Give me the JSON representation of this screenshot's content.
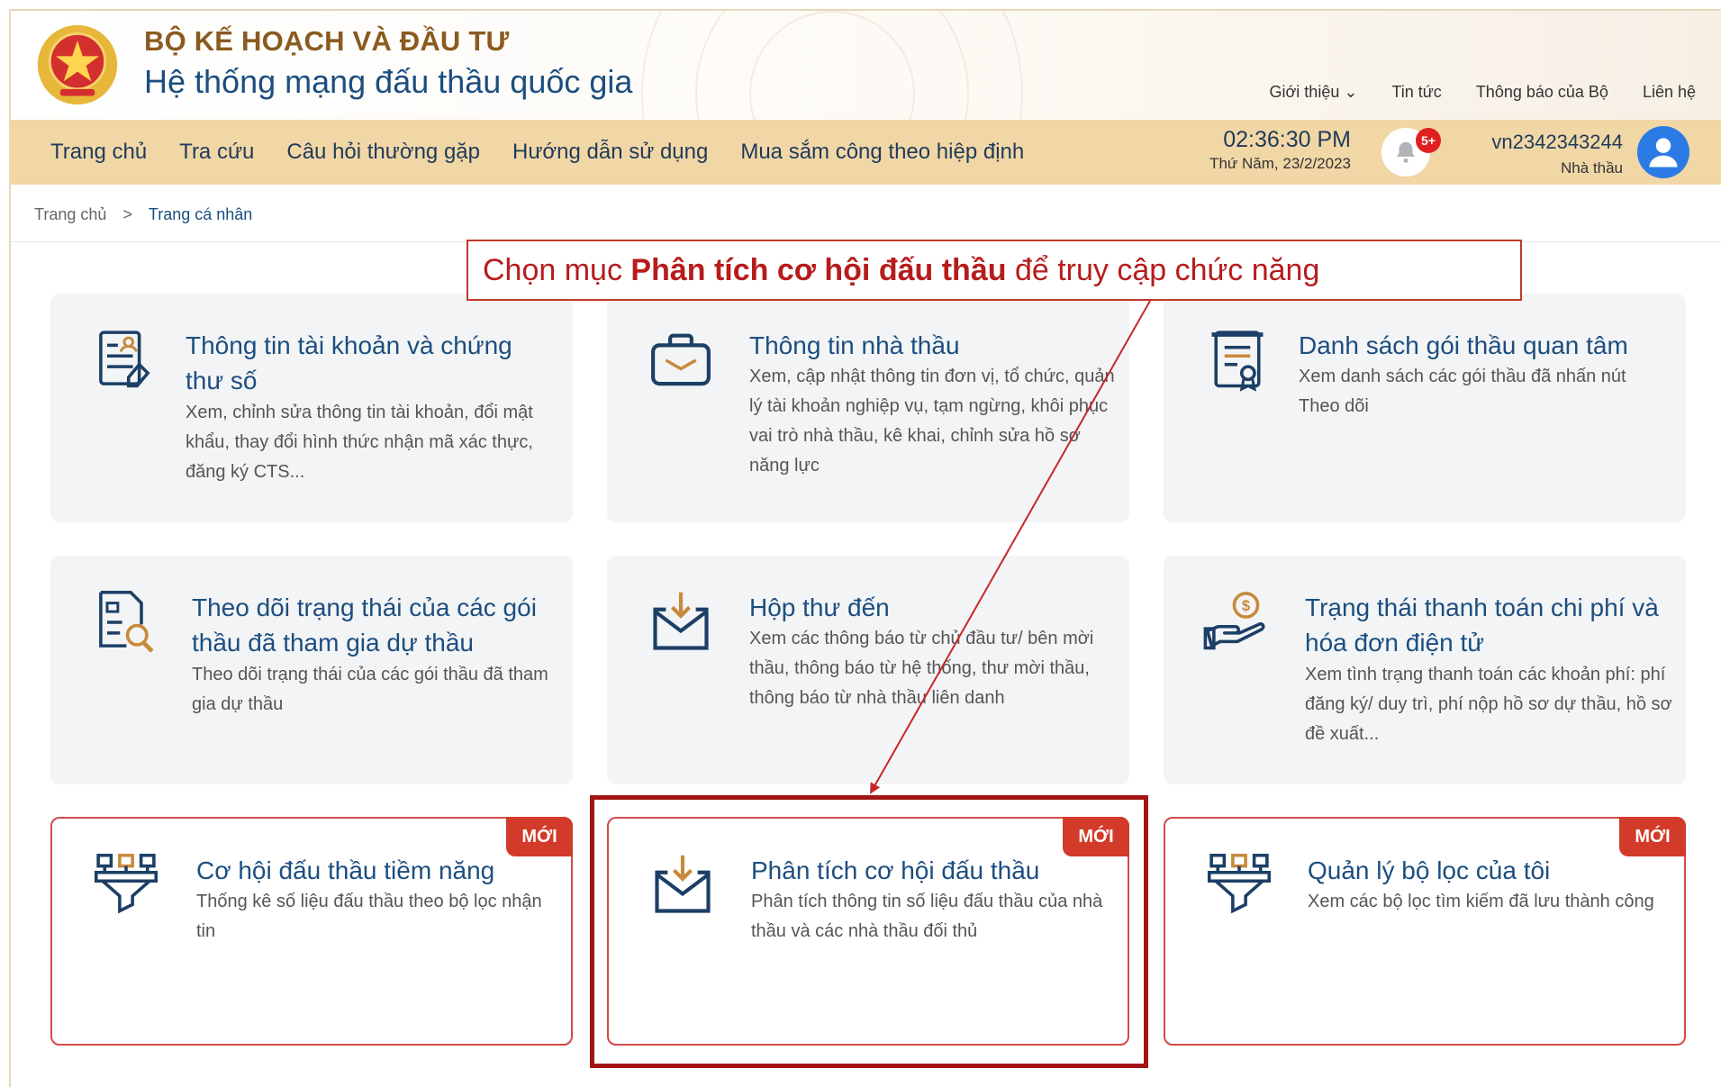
{
  "header": {
    "ministry": "BỘ KẾ HOẠCH VÀ ĐẦU TƯ",
    "system_name": "Hệ thống mạng đấu thầu quốc gia",
    "top_links": [
      "Giới thiệu ⌄",
      "Tin tức",
      "Thông báo của Bộ",
      "Liên hệ"
    ]
  },
  "nav": {
    "items": [
      "Trang chủ",
      "Tra cứu",
      "Câu hỏi thường gặp",
      "Hướng dẫn sử dụng",
      "Mua sắm công theo hiệp định"
    ],
    "time": "02:36:30 PM",
    "date": "Thứ Năm, 23/2/2023",
    "notification_badge": "5+",
    "username": "vn2342343244",
    "role": "Nhà thầu"
  },
  "breadcrumb": [
    "Trang chủ",
    ">",
    "Trang cá nhân"
  ],
  "callout": {
    "prefix": "Chọn mục ",
    "bold": "Phân tích cơ hội đấu thầu",
    "suffix": " để truy cập chức năng"
  },
  "new_label": "MỚI",
  "cards": [
    {
      "title": "Thông tin tài khoản và chứng thư số",
      "desc": "Xem, chỉnh sửa thông tin tài khoản, đổi mật khẩu, thay đổi hình thức nhận mã xác thực, đăng ký CTS...",
      "icon": "account-doc-icon"
    },
    {
      "title": "Thông tin nhà thầu",
      "desc": "Xem, cập nhật thông tin đơn vị, tổ chức, quản lý tài khoản nghiệp vụ, tạm ngừng, khôi phục vai trò nhà thầu, kê khai, chỉnh sửa hồ sơ năng lực",
      "icon": "briefcase-icon"
    },
    {
      "title": "Danh sách gói thầu quan tâm",
      "desc": "Xem danh sách các gói thầu đã nhấn nút Theo dõi",
      "icon": "certificate-icon"
    },
    {
      "title": "Theo dõi trạng thái của các gói thầu đã tham gia dự thầu",
      "desc": "Theo dõi trạng thái của các gói thầu đã tham gia dự thầu",
      "icon": "doc-search-icon"
    },
    {
      "title": "Hộp thư đến",
      "desc": "Xem các thông báo từ chủ đầu tư/ bên mời thầu, thông báo từ hệ thống, thư mời thầu, thông báo từ nhà thầu liên danh",
      "icon": "inbox-icon"
    },
    {
      "title": "Trạng thái thanh toán chi phí và hóa đơn điện tử",
      "desc": "Xem tình trạng thanh toán các khoản phí: phí đăng ký/ duy trì, phí nộp hồ sơ dự thầu, hồ sơ đề xuất...",
      "icon": "payment-hand-icon"
    },
    {
      "title": "Cơ hội đấu thầu tiềm năng",
      "desc": "Thống kê số liệu đấu thầu theo bộ lọc nhận tin",
      "icon": "filter-icon"
    },
    {
      "title": "Phân tích cơ hội đấu thầu",
      "desc": "Phân tích thông tin số liệu đấu thầu của nhà thầu và các nhà thầu đối thủ",
      "icon": "inbox-icon"
    },
    {
      "title": "Quản lý bộ lọc của tôi",
      "desc": "Xem các bộ lọc tìm kiếm đã lưu thành công",
      "icon": "filter-icon"
    }
  ]
}
